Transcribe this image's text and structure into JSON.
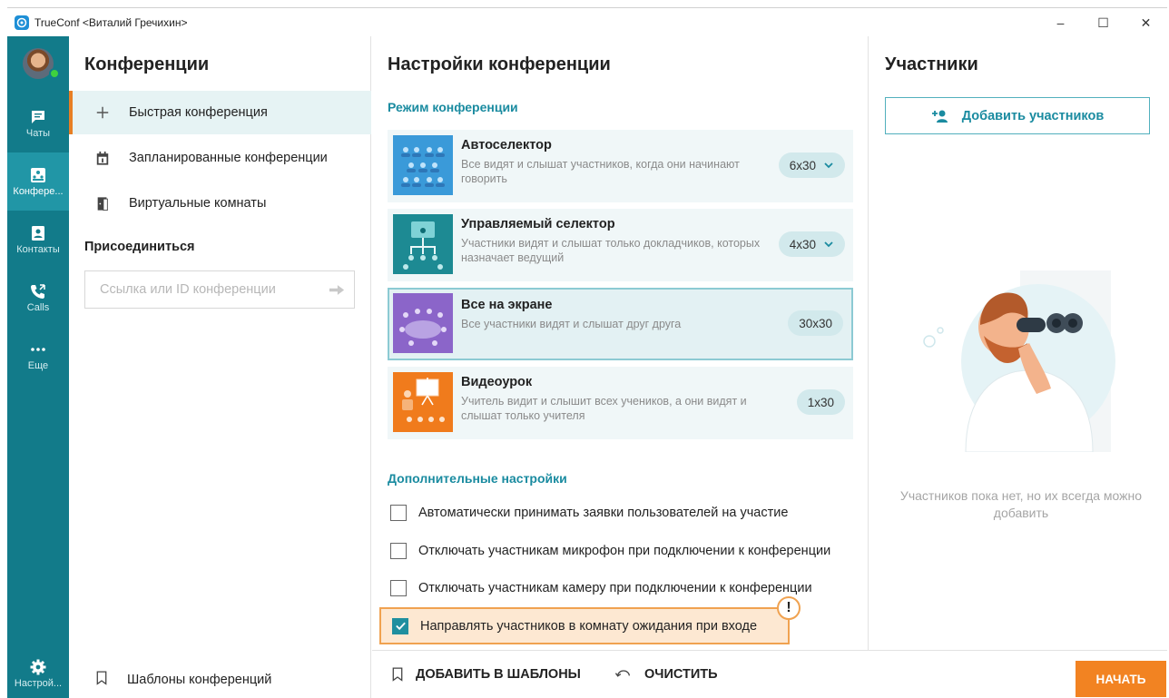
{
  "window": {
    "title": "TrueConf <Виталий Гречихин>",
    "controls": {
      "minimize": "–",
      "maximize": "☐",
      "close": "✕"
    }
  },
  "rail": {
    "items": [
      {
        "label": "Чаты",
        "icon": "chat-icon"
      },
      {
        "label": "Конфере...",
        "icon": "conference-icon",
        "active": true
      },
      {
        "label": "Контакты",
        "icon": "contacts-icon"
      },
      {
        "label": "Calls",
        "icon": "calls-icon"
      },
      {
        "label": "Еще",
        "icon": "more-icon"
      }
    ],
    "settings_label": "Настрой..."
  },
  "conferences": {
    "title": "Конференции",
    "menu": [
      {
        "label": "Быстрая конференция",
        "icon": "plus-icon",
        "active": true
      },
      {
        "label": "Запланированные конференции",
        "icon": "calendar-icon"
      },
      {
        "label": "Виртуальные комнаты",
        "icon": "door-icon"
      }
    ],
    "join_label": "Присоединиться",
    "join_placeholder": "Ссылка или ID конференции",
    "templates_label": "Шаблоны конференций"
  },
  "settings": {
    "title": "Настройки конференции",
    "mode_section": "Режим конференции",
    "modes": [
      {
        "name": "Автоселектор",
        "desc": "Все видят и слышат участников, когда они начинают говорить",
        "pill": "6x30",
        "dropdown": true,
        "color": "#3a9ad9",
        "icon": "autoselector-icon"
      },
      {
        "name": "Управляемый селектор",
        "desc": "Участники видят и слышат только докладчиков, которых назначает ведущий",
        "pill": "4x30",
        "dropdown": true,
        "color": "#1d8a93",
        "icon": "managed-selector-icon"
      },
      {
        "name": "Все на экране",
        "desc": "Все участники видят и слышат друг друга",
        "pill": "30x30",
        "dropdown": false,
        "selected": true,
        "color": "#8b65c9",
        "icon": "all-on-screen-icon"
      },
      {
        "name": "Видеоурок",
        "desc": "Учитель видит и слышит всех учеников, а они видят и слышат только учителя",
        "pill": "1x30",
        "dropdown": false,
        "color": "#f07b1c",
        "icon": "video-lesson-icon"
      }
    ],
    "extra_section": "Дополнительные настройки",
    "options": [
      {
        "label": "Автоматически принимать заявки пользователей на участие",
        "checked": false
      },
      {
        "label": "Отключать участникам микрофон при подключении к конференции",
        "checked": false
      },
      {
        "label": "Отключать участникам камеру при подключении к конференции",
        "checked": false
      },
      {
        "label": "Направлять участников в комнату ожидания при входе",
        "checked": true,
        "highlighted": true
      }
    ],
    "warning_mark": "!"
  },
  "participants": {
    "title": "Участники",
    "add_label": "Добавить участников",
    "empty_text": "Участников пока нет, но их всегда можно добавить"
  },
  "footer": {
    "add_to_templates": "ДОБАВИТЬ В ШАБЛОНЫ",
    "clear": "ОЧИСТИТЬ",
    "start": "НАЧАТЬ"
  },
  "colors": {
    "rail": "#127b8a",
    "rail_active": "#2196a6",
    "accent": "#1a8ba0",
    "start": "#f28322",
    "highlight_border": "#f0a250"
  }
}
